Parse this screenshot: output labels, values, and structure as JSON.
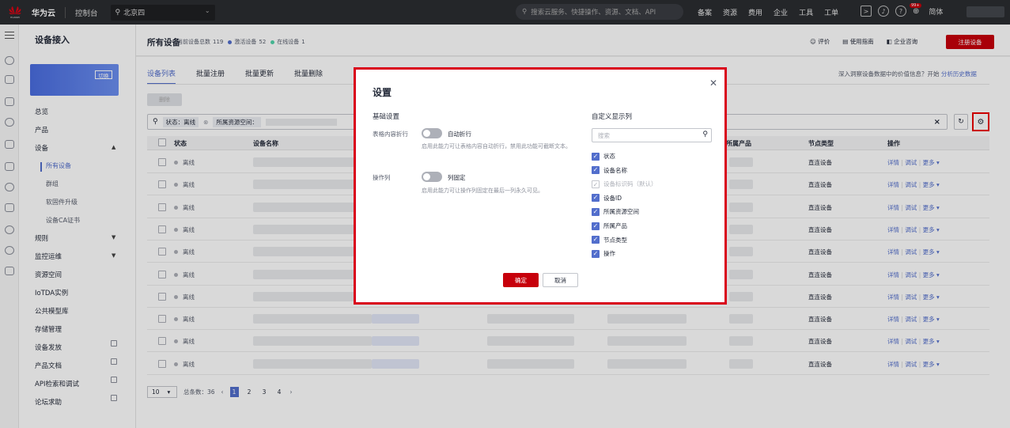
{
  "topbar": {
    "logo_text": "HUAWEI",
    "brand": "华为云",
    "console": "控制台",
    "region": "北京四",
    "search_placeholder": "搜索云服务、快捷操作、资源、文档、API",
    "nav": [
      "备案",
      "资源",
      "费用",
      "企业",
      "工具",
      "工单"
    ],
    "badge": "99+",
    "lang": "简体"
  },
  "sidebar": {
    "title": "设备接入",
    "switch_label": "切换",
    "items": [
      {
        "label": "总览"
      },
      {
        "label": "产品"
      },
      {
        "label": "设备"
      },
      {
        "label": "所有设备"
      },
      {
        "label": "群组"
      },
      {
        "label": "软固件升级"
      },
      {
        "label": "设备CA证书"
      },
      {
        "label": "规则"
      },
      {
        "label": "监控运维"
      },
      {
        "label": "资源空间"
      },
      {
        "label": "IoTDA实例"
      },
      {
        "label": "公共模型库"
      },
      {
        "label": "存储管理"
      },
      {
        "label": "设备发放"
      },
      {
        "label": "产品文档"
      },
      {
        "label": "API检索和调试"
      },
      {
        "label": "论坛求助"
      }
    ]
  },
  "page": {
    "title": "所有设备",
    "stats": {
      "total_label": "当前设备总数",
      "total": "119",
      "active_label": "激活设备",
      "active": "52",
      "online_label": "在线设备",
      "online": "1"
    },
    "actions": [
      "评价",
      "使用指南",
      "企业咨询"
    ],
    "register_btn": "注册设备",
    "tabs": [
      "设备列表",
      "批量注册",
      "批量更新",
      "批量删除"
    ],
    "insight_text": "深入洞察设备数据中的价值信息？开始",
    "insight_link": "分析历史数据",
    "delete_btn": "删除",
    "filter_chip1": "状态：离线",
    "filter_chip2": "所属资源空间："
  },
  "table": {
    "headers": [
      "状态",
      "设备名称",
      "所属产品",
      "节点类型",
      "操作"
    ],
    "rows": [
      {
        "status": "离线",
        "node": "直连设备"
      },
      {
        "status": "离线",
        "node": "直连设备"
      },
      {
        "status": "离线",
        "node": "直连设备"
      },
      {
        "status": "离线",
        "node": "直连设备"
      },
      {
        "status": "离线",
        "node": "直连设备"
      },
      {
        "status": "离线",
        "node": "直连设备"
      },
      {
        "status": "离线",
        "node": "直连设备"
      },
      {
        "status": "离线",
        "node": "直连设备"
      },
      {
        "status": "离线",
        "node": "直连设备"
      },
      {
        "status": "离线",
        "node": "直连设备"
      }
    ],
    "ops": [
      "详情",
      "调试",
      "更多"
    ]
  },
  "pager": {
    "size": "10",
    "total_label": "总条数：",
    "total": "36",
    "pages": [
      "1",
      "2",
      "3",
      "4"
    ]
  },
  "modal": {
    "title": "设置",
    "basic_title": "基础设置",
    "wrap_label": "表格内容折行",
    "wrap_toggle": "自动折行",
    "wrap_desc": "启用此能力可让表格内容自动折行，禁用此功能可截断文本。",
    "fixed_label": "操作列",
    "fixed_toggle": "列固定",
    "fixed_desc": "启用此能力可让操作列固定在最后一列永久可见。",
    "custom_title": "自定义显示列",
    "search_placeholder": "搜索",
    "columns": [
      {
        "label": "状态",
        "checked": true,
        "disabled": false
      },
      {
        "label": "设备名称",
        "checked": true,
        "disabled": false
      },
      {
        "label": "设备标识码（默认）",
        "checked": true,
        "disabled": true
      },
      {
        "label": "设备ID",
        "checked": true,
        "disabled": false
      },
      {
        "label": "所属资源空间",
        "checked": true,
        "disabled": false
      },
      {
        "label": "所属产品",
        "checked": true,
        "disabled": false
      },
      {
        "label": "节点类型",
        "checked": true,
        "disabled": false
      },
      {
        "label": "操作",
        "checked": true,
        "disabled": false
      }
    ],
    "ok": "确定",
    "cancel": "取消"
  },
  "colors": {
    "accent": "#526ecc",
    "brand_red": "#c7000b",
    "highlight_border": "#d9001b"
  }
}
